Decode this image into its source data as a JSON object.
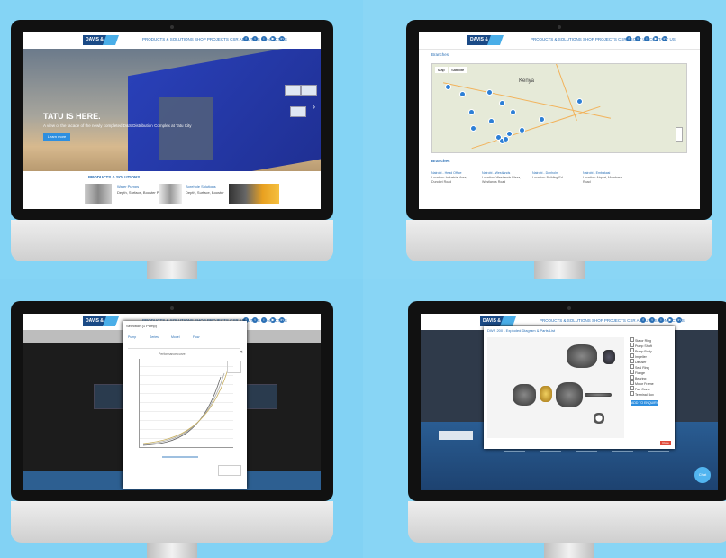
{
  "colors": {
    "accent": "#2a6fb5",
    "brand_dark": "#1a4a86",
    "button_blue": "#2e8fe0",
    "footer_blue": "#2d5f91"
  },
  "site": {
    "logo_text": "DAVIS & SHIRTLIFF",
    "nav_menu": "PRODUCTS & SOLUTIONS   SHOP   PROJECTS   CSR   ABOUT US   CONTACT US",
    "social_icons": [
      "facebook-icon",
      "twitter-icon",
      "instagram-icon",
      "youtube-icon",
      "linkedin-icon"
    ]
  },
  "q1": {
    "hero_title": "TATU IS HERE.",
    "hero_subtitle": "A view of the facade of the newly completed D&S Distribution Complex at Tatu City",
    "hero_button": "Learn more",
    "products_heading": "PRODUCTS & SOLUTIONS",
    "product_1": "Water Pumps",
    "product_1_desc": "Depth, Surface, Booster Pumps, Solar",
    "product_2": "Borehole Solutions",
    "product_2_desc": "Depth, Surface, Booster"
  },
  "q2": {
    "breadcrumb": "Branches",
    "map_tab_1": "Map",
    "map_tab_2": "Satellite",
    "map_label": "Kenya",
    "branches_title": "Branches",
    "columns": [
      {
        "head": "Nairobi - Head Office",
        "body": "Location: Industrial Area, Dundori Road"
      },
      {
        "head": "Nairobi - Westlands",
        "body": "Location: Westlands Plaza, Westlands Road"
      },
      {
        "head": "Nairobi - Donholm",
        "body": "Location: Building Ed"
      },
      {
        "head": "Nairobi - Embakasi",
        "body": "Location: Airport, Mombasa Road"
      }
    ]
  },
  "q3": {
    "dialog_title": "Selection (1 Pump)",
    "selectors": [
      "Pump",
      "Series",
      "Model",
      "Flow"
    ],
    "chart_caption": "Performance curve"
  },
  "q4": {
    "dialog_title": "DWS 200 - Exploded Diagram & Parts List",
    "parts": [
      "Stator Ring",
      "Pump Shaft",
      "Pump Body",
      "Impeller",
      "Diffuser",
      "Seal Ring",
      "Flange",
      "Bearing",
      "Motor Frame",
      "Fan Cover",
      "Terminal Box"
    ],
    "button": "ADD TO ENQUIRY",
    "close": "Close",
    "chat": "Chat"
  }
}
